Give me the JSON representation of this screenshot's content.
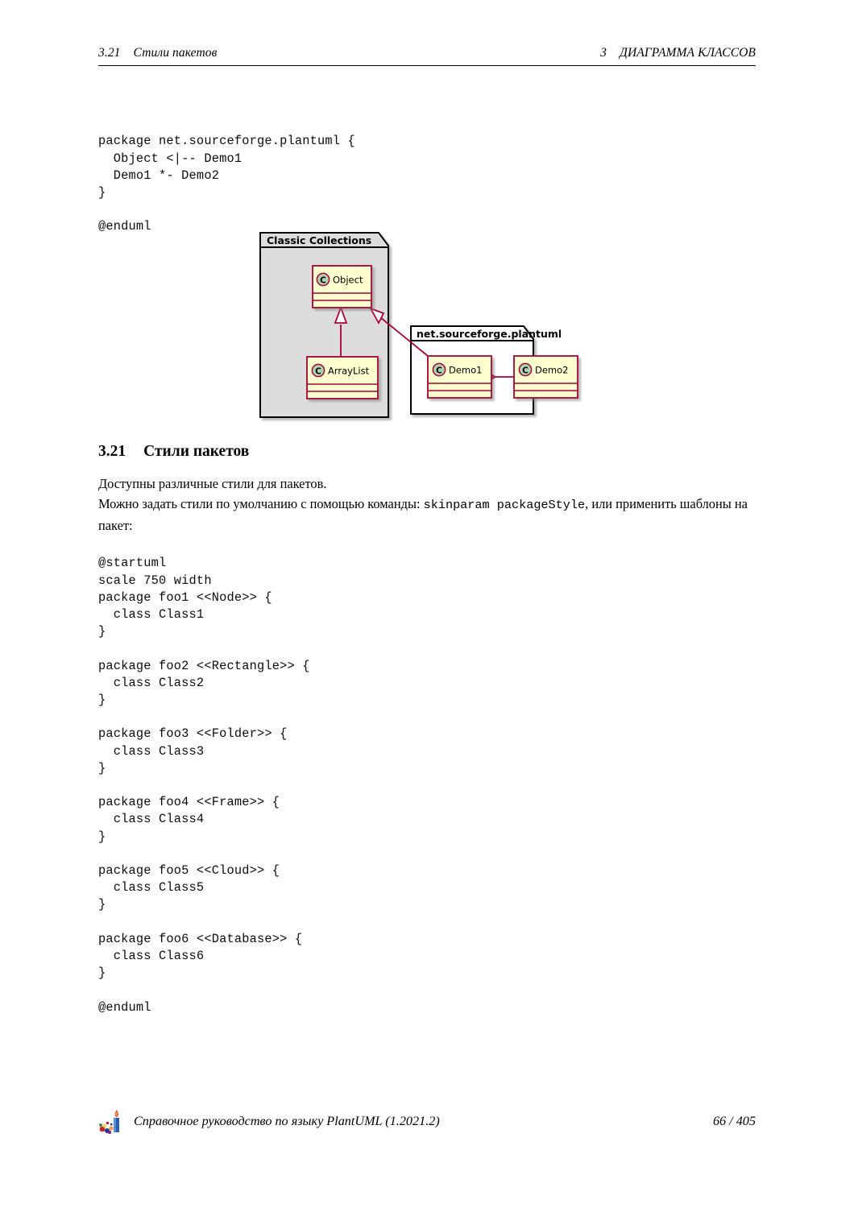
{
  "header": {
    "left_number": "3.21",
    "left_title": "Стили пакетов",
    "right_number": "3",
    "right_title": "ДИАГРАММА КЛАССОВ"
  },
  "code_top": "package net.sourceforge.plantuml {\n  Object <|-- Demo1\n  Demo1 *- Demo2\n}\n\n@enduml",
  "diagram": {
    "type": "plantuml-class-diagram",
    "packages": [
      {
        "name": "Classic Collections",
        "style": "folder",
        "fill": "#DDDDDD",
        "classes": [
          "Object",
          "ArrayList"
        ]
      },
      {
        "name": "net.sourceforge.plantuml",
        "style": "folder",
        "fill": "#FFFFFF",
        "classes": [
          "Demo1",
          "Demo2"
        ]
      }
    ],
    "class_stereotype_letter": "C",
    "class_fill": "#FEFECE",
    "class_border": "#A80036",
    "stereotype_circle_fill": "#ADD1B2",
    "relations": [
      {
        "from": "ArrayList",
        "to": "Object",
        "kind": "inheritance"
      },
      {
        "from": "Demo1",
        "to": "Object",
        "kind": "inheritance"
      },
      {
        "from": "Demo1",
        "to": "Demo2",
        "kind": "composition"
      }
    ]
  },
  "section": {
    "number": "3.21",
    "title": "Стили пакетов"
  },
  "paragraphs": {
    "p1": "Доступны различные стили для пакетов.",
    "p2_before": "Можно задать стили по умолчанию с помощью команды: ",
    "p2_code": "skinparam packageStyle",
    "p2_after": ", или применить шаблоны на пакет:"
  },
  "code_main": "@startuml\nscale 750 width\npackage foo1 <<Node>> {\n  class Class1\n}\n\npackage foo2 <<Rectangle>> {\n  class Class2\n}\n\npackage foo3 <<Folder>> {\n  class Class3\n}\n\npackage foo4 <<Frame>> {\n  class Class4\n}\n\npackage foo5 <<Cloud>> {\n  class Class5\n}\n\npackage foo6 <<Database>> {\n  class Class6\n}\n\n@enduml",
  "footer": {
    "title": "Справочное руководство по языку PlantUML (1.2021.2)",
    "page": "66 / 405",
    "logo": "plantuml-logo-icon"
  }
}
